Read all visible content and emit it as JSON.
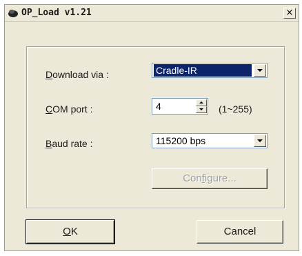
{
  "window": {
    "title": "OP_Load v1.21",
    "close_label": "×"
  },
  "form": {
    "download_via": {
      "label": "Download via :",
      "mnemonic": "D",
      "value": "Cradle-IR"
    },
    "com_port": {
      "label": "COM port :",
      "mnemonic": "C",
      "value": "4",
      "range_hint": "(1~255)"
    },
    "baud_rate": {
      "label": "Baud rate :",
      "mnemonic": "B",
      "value": "115200 bps"
    }
  },
  "buttons": {
    "configure": "Configure...",
    "ok": "OK",
    "cancel": "Cancel"
  },
  "icons": {
    "app": "app-logo-icon",
    "close": "close-icon",
    "dropdown": "chevron-down-icon",
    "spin_up": "spin-up-icon",
    "spin_down": "spin-down-icon"
  },
  "colors": {
    "dialog_bg": "#ece9d8",
    "selection": "#0b246a",
    "field_border": "#7f9db9",
    "disabled_text": "#a0a0a0"
  }
}
